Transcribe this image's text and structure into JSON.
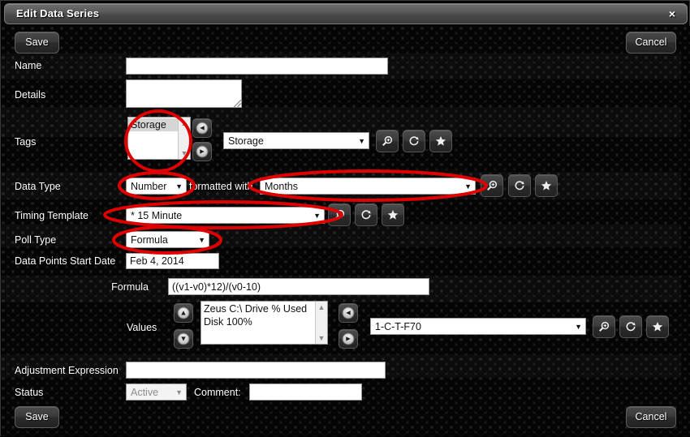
{
  "window": {
    "title": "Edit Data Series",
    "close_label": "×"
  },
  "toolbar": {
    "save_label": "Save",
    "cancel_label": "Cancel"
  },
  "footer": {
    "save_label": "Save",
    "cancel_label": "Cancel"
  },
  "fields": {
    "name": {
      "label": "Name",
      "value": ""
    },
    "details": {
      "label": "Details",
      "value": ""
    },
    "tags": {
      "label": "Tags",
      "list": [
        "Storage"
      ],
      "selected": "Storage",
      "dropdown_value": "Storage"
    },
    "data_type": {
      "label": "Data Type",
      "value": "Number",
      "middle_label": "formatted with",
      "format_value": "Months"
    },
    "timing_template": {
      "label": "Timing Template",
      "value": "* 15 Minute"
    },
    "poll_type": {
      "label": "Poll Type",
      "value": "Formula"
    },
    "start_date": {
      "label": "Data Points Start Date",
      "value": "Feb 4, 2014"
    },
    "formula": {
      "label": "Formula",
      "value": "((v1-v0)*12)/(v0-10)"
    },
    "values": {
      "label": "Values",
      "list": [
        "Zeus C:\\ Drive % Used",
        "Disk 100%"
      ],
      "dropdown_value": "1-C-T-F70"
    },
    "adjustment_expression": {
      "label": "Adjustment Expression",
      "value": ""
    },
    "status": {
      "label": "Status",
      "value": "Active",
      "comment_label": "Comment:",
      "comment_value": ""
    }
  },
  "icons": {
    "search": "magnifier-icon",
    "refresh": "refresh-icon",
    "star": "star-icon",
    "caret": "▼",
    "arrow_left": "◄",
    "arrow_right": "►",
    "arrow_up": "▲",
    "arrow_down": "▼"
  },
  "colors": {
    "annotation": "#e00000",
    "titlebar": "#5a5a5a",
    "background": "#050505"
  }
}
